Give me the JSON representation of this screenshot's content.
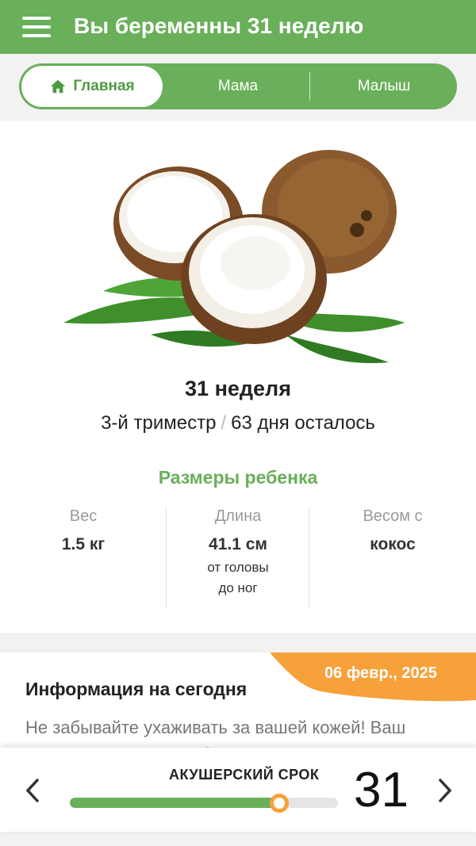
{
  "header": {
    "title": "Вы беременны 31 неделю",
    "menu_icon": "hamburger-menu-icon"
  },
  "tabs": [
    {
      "label": "Главная",
      "icon": "home-icon",
      "active": true
    },
    {
      "label": "Мама",
      "active": false
    },
    {
      "label": "Малыш",
      "active": false
    }
  ],
  "summary": {
    "week_title": "31 неделя",
    "trimester": "3-й триместр",
    "separator": "/",
    "days_left": "63 дня осталось",
    "image": "coconut"
  },
  "sizes": {
    "title": "Размеры ребенка",
    "weight": {
      "label": "Вес",
      "value": "1.5 кг"
    },
    "length": {
      "label": "Длина",
      "value": "41.1 см",
      "note_line1": "от головы",
      "note_line2": "до ног"
    },
    "compare": {
      "label": "Весом с",
      "value": "кокос"
    }
  },
  "info": {
    "date": "06 февр., 2025",
    "title": "Информация на сегодня",
    "text": "Не забывайте ухаживать за вашей кожей! Ваш животик стал совсем большим, а кожа"
  },
  "bottom": {
    "label": "АКУШЕРСКИЙ СРОК",
    "week": "31",
    "progress": 0.78
  },
  "colors": {
    "brand_green": "#6aaf5a",
    "accent_orange": "#f7a13b"
  }
}
